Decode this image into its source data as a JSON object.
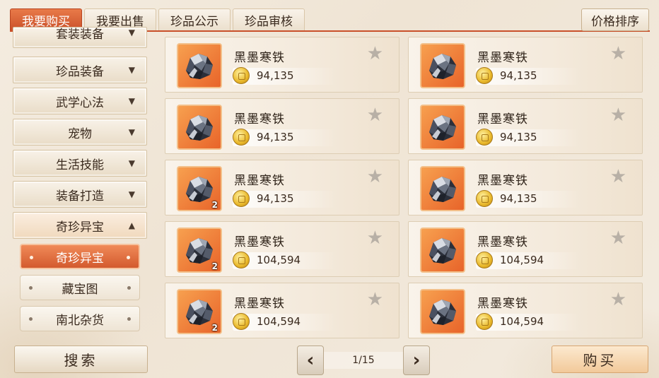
{
  "tabs": [
    {
      "label": "我要购买",
      "active": true
    },
    {
      "label": "我要出售",
      "active": false
    },
    {
      "label": "珍品公示",
      "active": false
    },
    {
      "label": "珍品审核",
      "active": false
    }
  ],
  "sort_label": "价格排序",
  "sidebar": {
    "categories": [
      {
        "label": "套装装备",
        "arrow": "▼"
      },
      {
        "label": "珍品装备",
        "arrow": "▼"
      },
      {
        "label": "武学心法",
        "arrow": "▼"
      },
      {
        "label": "宠物",
        "arrow": "▼"
      },
      {
        "label": "生活技能",
        "arrow": "▼"
      },
      {
        "label": "装备打造",
        "arrow": "▼"
      },
      {
        "label": "奇珍异宝",
        "arrow": "▲",
        "open": true
      }
    ],
    "subcategories": [
      {
        "label": "奇珍异宝",
        "active": true
      },
      {
        "label": "藏宝图",
        "active": false
      },
      {
        "label": "南北杂货",
        "active": false
      }
    ]
  },
  "search_label": "搜索",
  "items": [
    {
      "name": "黑墨寒铁",
      "price": "94,135",
      "qty": ""
    },
    {
      "name": "黑墨寒铁",
      "price": "94,135",
      "qty": ""
    },
    {
      "name": "黑墨寒铁",
      "price": "94,135",
      "qty": ""
    },
    {
      "name": "黑墨寒铁",
      "price": "94,135",
      "qty": ""
    },
    {
      "name": "黑墨寒铁",
      "price": "94,135",
      "qty": "2"
    },
    {
      "name": "黑墨寒铁",
      "price": "94,135",
      "qty": ""
    },
    {
      "name": "黑墨寒铁",
      "price": "104,594",
      "qty": "2"
    },
    {
      "name": "黑墨寒铁",
      "price": "104,594",
      "qty": ""
    },
    {
      "name": "黑墨寒铁",
      "price": "104,594",
      "qty": "2"
    },
    {
      "name": "黑墨寒铁",
      "price": "104,594",
      "qty": ""
    }
  ],
  "pager": {
    "text": "1/15",
    "prev": "‹",
    "next": "›"
  },
  "buy_label": "购买",
  "colors": {
    "accent": "#d35a2e",
    "item_bg": "#e8642a"
  }
}
